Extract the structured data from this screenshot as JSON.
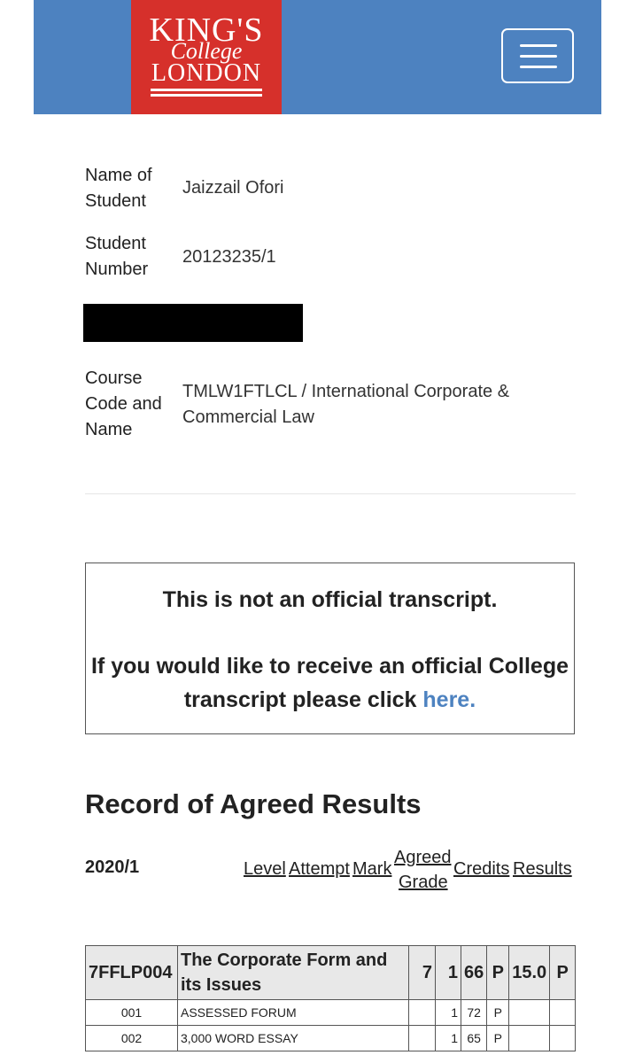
{
  "header": {
    "logo": {
      "line1": "KING'S",
      "line2": "College",
      "line3": "LONDON"
    },
    "menu_icon": "hamburger-menu-icon",
    "colors": {
      "bar": "#4d82c0",
      "logo_bg": "#d6302b"
    }
  },
  "student": {
    "name_label": "Name of Student",
    "name": "Jaizzail Ofori",
    "number_label": "Student Number",
    "number": "20123235/1",
    "course_label": "Course Code and Name",
    "course": "TMLW1FTLCL  /  International Corporate & Commercial Law"
  },
  "notice": {
    "line1": "This is not an official transcript.",
    "line2": "If you would like to receive an official College transcript please click",
    "link": "here."
  },
  "results": {
    "title": "Record of Agreed Results",
    "year": "2020/1",
    "columns": {
      "level": "Level",
      "attempt": "Attempt",
      "mark": "Mark",
      "agreed": "Agreed",
      "grade": "Grade",
      "credits": "Credits",
      "results": "Results"
    },
    "module": {
      "code": "7FFLP004",
      "title": "The Corporate Form and its Issues",
      "level": "7",
      "attempt": "1",
      "mark": "66",
      "grade": "P",
      "credits": "15.0",
      "result": "P"
    },
    "assessments": [
      {
        "code": "001",
        "name": "ASSESSED FORUM",
        "attempt": "1",
        "mark": "72",
        "grade": "P"
      },
      {
        "code": "002",
        "name": "3,000 WORD ESSAY",
        "attempt": "1",
        "mark": "65",
        "grade": "P"
      }
    ]
  }
}
